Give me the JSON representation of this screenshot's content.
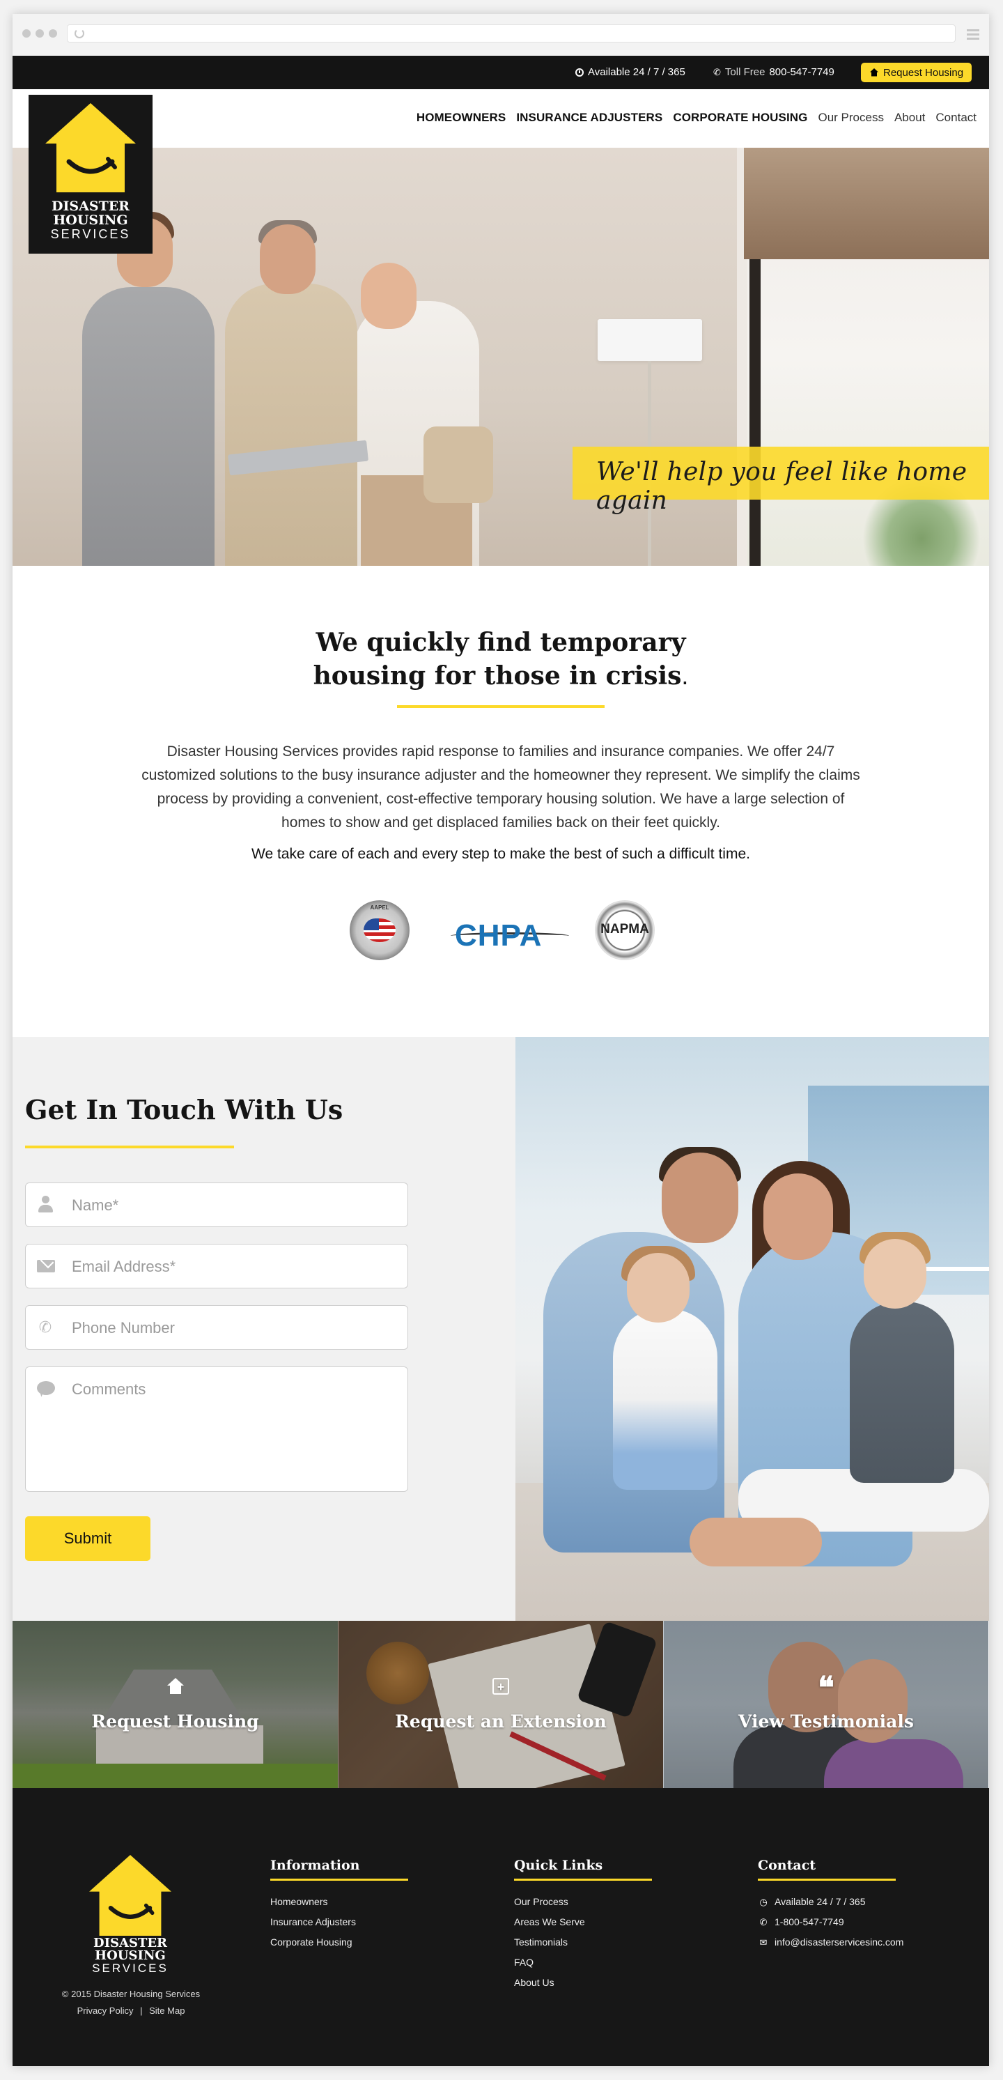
{
  "colors": {
    "accent": "#fcd92a",
    "dark": "#141414",
    "footer": "#171717"
  },
  "topbar": {
    "availability": "Available 24 / 7 / 365",
    "phone_label": "Toll Free",
    "phone_number": "800-547-7749",
    "request_button": "Request Housing",
    "icons": {
      "availability": "clock-icon",
      "phone": "phone-icon",
      "request": "home-icon"
    }
  },
  "nav": {
    "items": [
      {
        "label": "HOMEOWNERS"
      },
      {
        "label": "INSURANCE ADJUSTERS"
      },
      {
        "label": "CORPORATE HOUSING"
      },
      {
        "label": "Our Process"
      },
      {
        "label": "About"
      },
      {
        "label": "Contact"
      }
    ]
  },
  "logo": {
    "line1": "DISASTER",
    "line2": "HOUSING",
    "line3": "SERVICES"
  },
  "hero": {
    "tagline": "We'll help you feel like home again"
  },
  "intro": {
    "heading_line1": "We quickly find temporary",
    "heading_line2": "housing for those in crisis",
    "heading_period": ".",
    "description": "Disaster Housing Services provides rapid response to families and insurance companies. We offer 24/7 customized solutions to the busy insurance adjuster and the homeowner they represent. We simplify the claims process by providing a convenient, cost-effective temporary housing solution. We have a large selection of homes to show and get displaced families back on their feet quickly.",
    "emphasis": "We take care of each and every step to make the best of such a difficult time.",
    "badges": [
      {
        "text": "AAPEL"
      },
      {
        "text": "CHPA"
      },
      {
        "text": "NAPMA"
      }
    ]
  },
  "contact": {
    "title": "Get In Touch With Us",
    "name_placeholder": "Name*",
    "email_placeholder": "Email Address*",
    "phone_placeholder": "Phone Number",
    "comments_placeholder": "Comments",
    "submit_label": "Submit"
  },
  "tiles": [
    {
      "label": "Request Housing",
      "icon": "home-icon"
    },
    {
      "label": "Request an Extension",
      "icon": "calendar-plus-icon"
    },
    {
      "label": "View Testimonials",
      "icon": "quote-icon"
    }
  ],
  "footer": {
    "copyright": "© 2015 Disaster Housing Services",
    "privacy": "Privacy Policy",
    "sitemap": "Site Map",
    "separator": "|",
    "information": {
      "title": "Information",
      "items": [
        "Homeowners",
        "Insurance Adjusters",
        "Corporate Housing"
      ]
    },
    "quick_links": {
      "title": "Quick Links",
      "items": [
        "Our Process",
        "Areas We Serve",
        "Testimonials",
        "FAQ",
        "About Us"
      ]
    },
    "contact": {
      "title": "Contact",
      "availability": "Available 24 / 7 / 365",
      "phone": "1-800-547-7749",
      "email": "info@disasterservicesinc.com"
    }
  }
}
